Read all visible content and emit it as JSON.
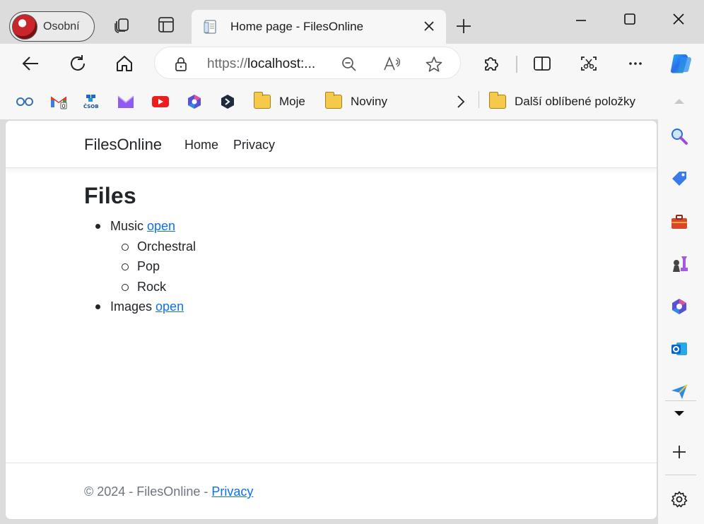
{
  "profile": {
    "label": "Osobní"
  },
  "tab": {
    "title": "Home page - FilesOnline"
  },
  "address": {
    "scheme": "https://",
    "host": "localhost:..."
  },
  "favorites": {
    "folders": [
      {
        "label": "Moje"
      },
      {
        "label": "Noviny"
      }
    ],
    "other": "Další oblíbené položky"
  },
  "site": {
    "brand": "FilesOnline",
    "nav": [
      {
        "label": "Home"
      },
      {
        "label": "Privacy"
      }
    ],
    "heading": "Files",
    "items": [
      {
        "name": "Music",
        "link": "open",
        "children": [
          "Orchestral",
          "Pop",
          "Rock"
        ]
      },
      {
        "name": "Images",
        "link": "open",
        "children": []
      }
    ],
    "footer": {
      "text": "© 2024 - FilesOnline - ",
      "link": "Privacy"
    }
  },
  "colors": {
    "link": "#0d6efd",
    "muted": "#6c757d",
    "text": "#212529"
  }
}
